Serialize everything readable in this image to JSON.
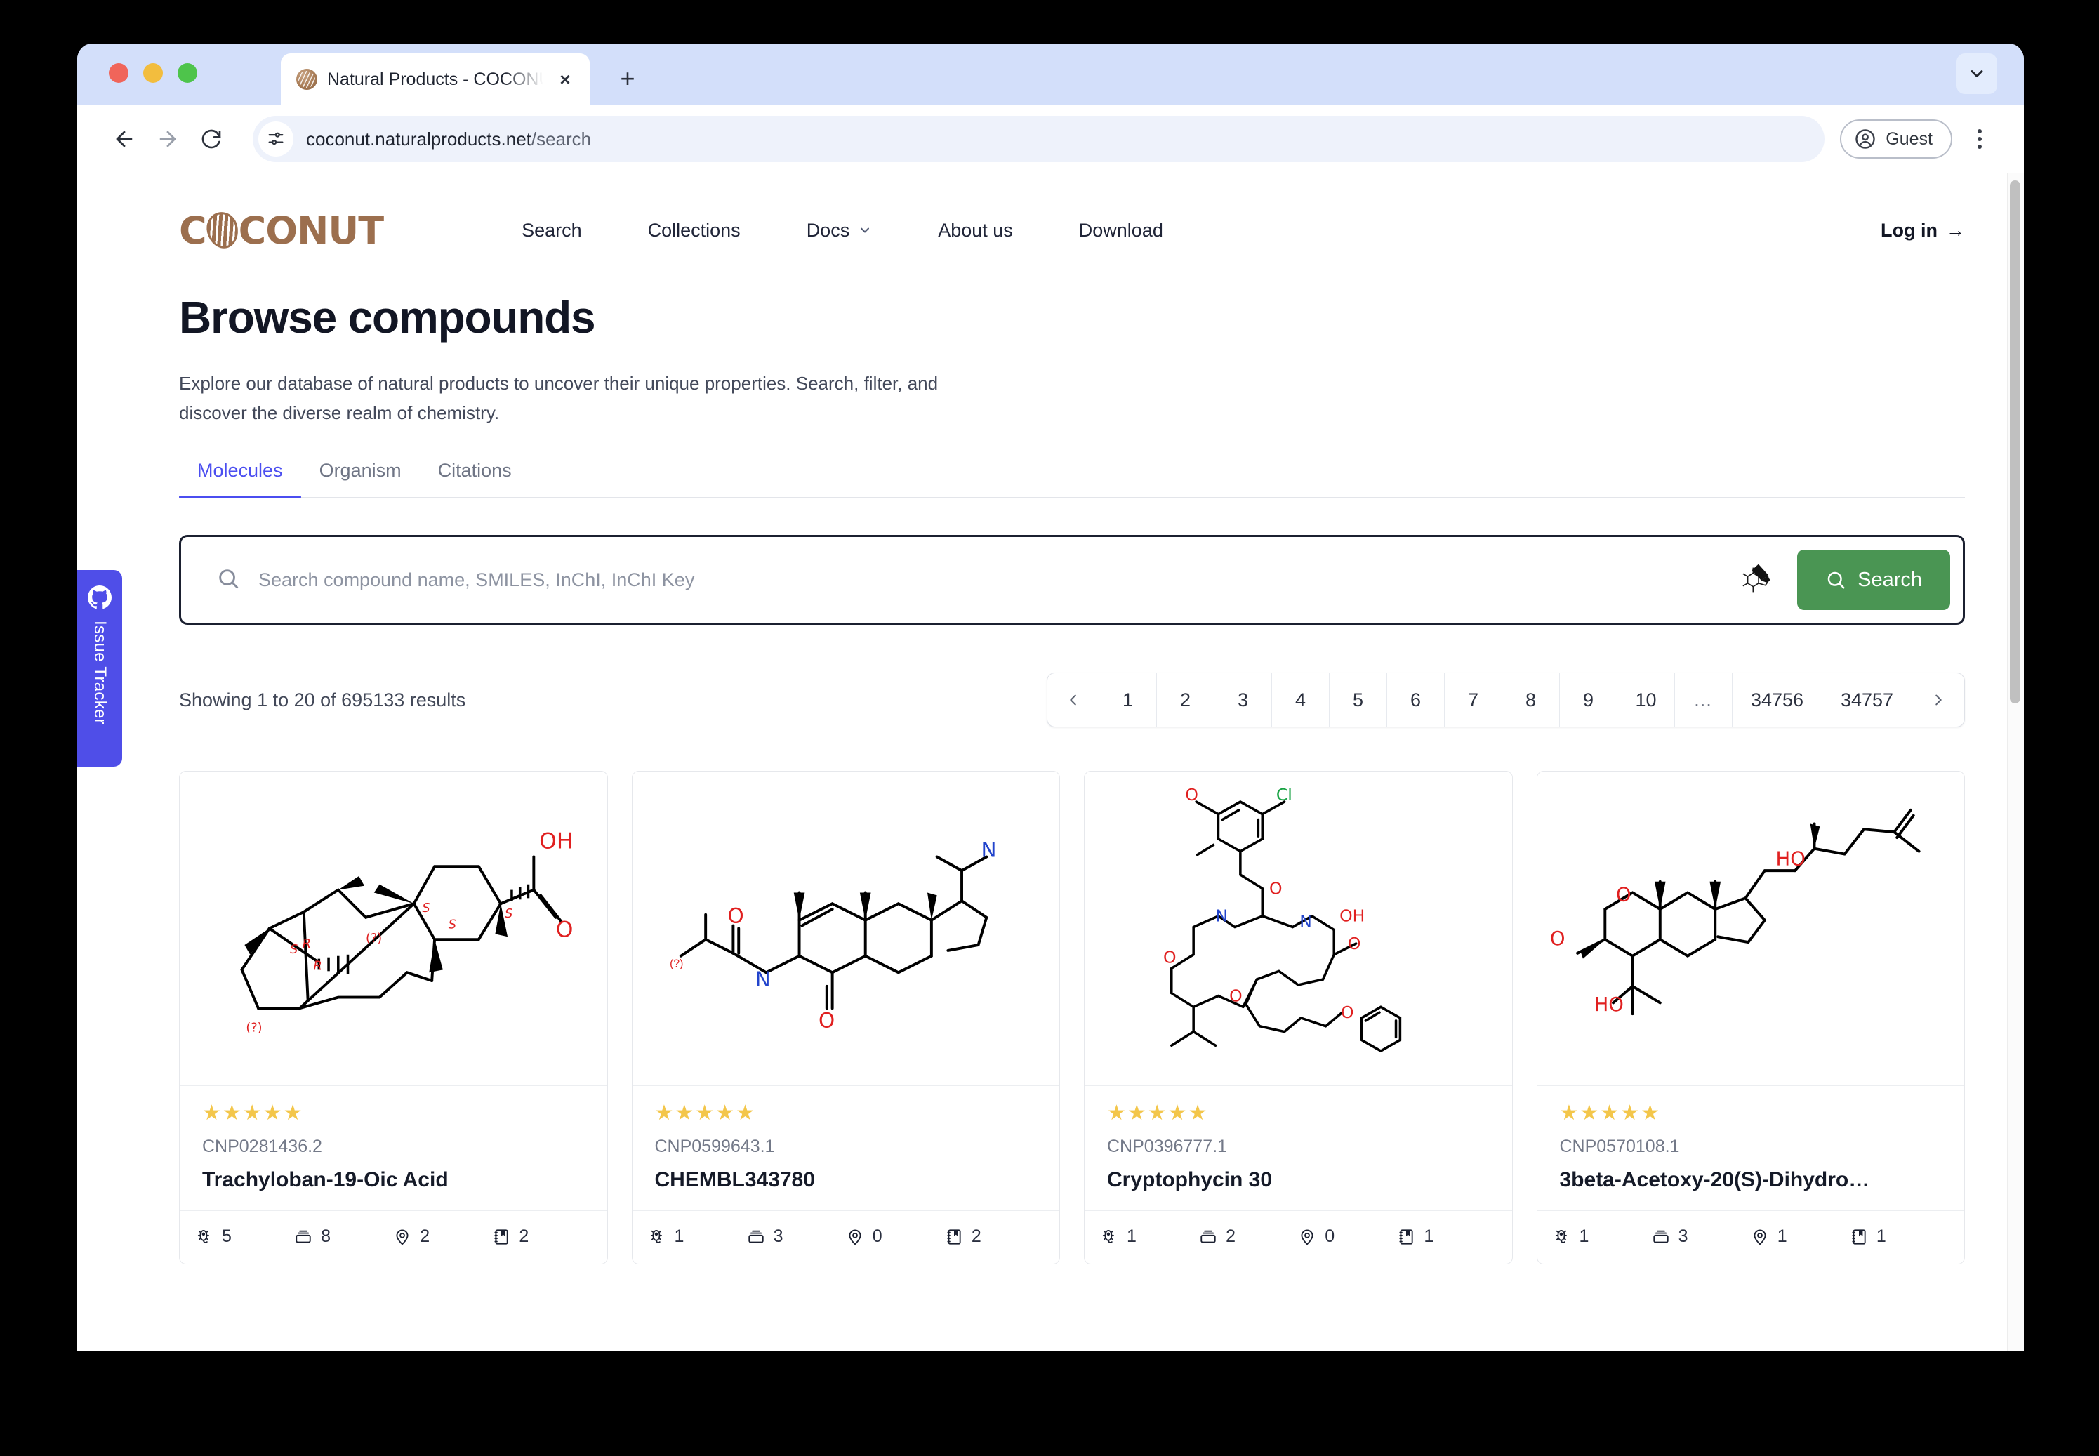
{
  "browser": {
    "tab_title": "Natural Products - COCONUT",
    "tab_favicon_name": "coconut-favicon",
    "new_tab_label": "+",
    "close_label": "×",
    "url_main": "coconut.naturalproducts.net",
    "url_path": "/search",
    "profile_label": "Guest",
    "back_icon": "back-arrow-icon",
    "forward_icon": "forward-arrow-icon",
    "reload_icon": "reload-icon",
    "site_info_icon": "site-settings-icon",
    "menu_icon": "kebab-menu-icon",
    "tabstrip_expand_icon": "chevron-down-icon"
  },
  "site": {
    "logo_text_left": "C",
    "logo_text_right": "CONUT",
    "nav": [
      {
        "label": "Search",
        "name": "nav-search"
      },
      {
        "label": "Collections",
        "name": "nav-collections"
      },
      {
        "label": "Docs",
        "name": "nav-docs",
        "caret": true
      },
      {
        "label": "About us",
        "name": "nav-about-us"
      },
      {
        "label": "Download",
        "name": "nav-download"
      }
    ],
    "login_label": "Log in",
    "login_arrow": "→"
  },
  "page": {
    "title": "Browse compounds",
    "description": "Explore our database of natural products to uncover their unique properties. Search, filter, and discover the diverse realm of chemistry.",
    "tabs": [
      {
        "label": "Molecules",
        "active": true
      },
      {
        "label": "Organism",
        "active": false
      },
      {
        "label": "Citations",
        "active": false
      }
    ]
  },
  "search": {
    "placeholder": "Search compound name, SMILES, InChI, InChI Key",
    "value": "",
    "button_label": "Search",
    "button_color": "#4a9553",
    "sketcher_icon": "molecule-sketcher-icon",
    "magnifier_icon": "search-icon"
  },
  "results": {
    "summary": "Showing 1 to 20 of 695133 results",
    "pagination": {
      "prev_icon": "chevron-left-icon",
      "next_icon": "chevron-right-icon",
      "pages": [
        "1",
        "2",
        "3",
        "4",
        "5",
        "6",
        "7",
        "8",
        "9",
        "10",
        "…",
        "34756",
        "34757"
      ],
      "current": "1"
    }
  },
  "cards": [
    {
      "rating": "★★★★★",
      "id": "CNP0281436.2",
      "name": "Trachyloban-19-Oic Acid",
      "structure": "trachyloban-19-oic-acid-structure",
      "stats": [
        {
          "icon": "organism-icon",
          "value": "5"
        },
        {
          "icon": "collection-icon",
          "value": "8"
        },
        {
          "icon": "geo-location-icon",
          "value": "2"
        },
        {
          "icon": "citation-icon",
          "value": "2"
        }
      ]
    },
    {
      "rating": "★★★★★",
      "id": "CNP0599643.1",
      "name": "CHEMBL343780",
      "structure": "chembl343780-structure",
      "stats": [
        {
          "icon": "organism-icon",
          "value": "1"
        },
        {
          "icon": "collection-icon",
          "value": "3"
        },
        {
          "icon": "geo-location-icon",
          "value": "0"
        },
        {
          "icon": "citation-icon",
          "value": "2"
        }
      ]
    },
    {
      "rating": "★★★★★",
      "id": "CNP0396777.1",
      "name": "Cryptophycin 30",
      "structure": "cryptophycin-30-structure",
      "stats": [
        {
          "icon": "organism-icon",
          "value": "1"
        },
        {
          "icon": "collection-icon",
          "value": "2"
        },
        {
          "icon": "geo-location-icon",
          "value": "0"
        },
        {
          "icon": "citation-icon",
          "value": "1"
        }
      ]
    },
    {
      "rating": "★★★★★",
      "id": "CNP0570108.1",
      "name": "3beta-Acetoxy-20(S)-Dihydro…",
      "structure": "3beta-acetoxy-20s-dihydro-structure",
      "stats": [
        {
          "icon": "organism-icon",
          "value": "1"
        },
        {
          "icon": "collection-icon",
          "value": "3"
        },
        {
          "icon": "geo-location-icon",
          "value": "1"
        },
        {
          "icon": "citation-icon",
          "value": "1"
        }
      ]
    }
  ],
  "issue_tracker": {
    "label": "Issue Tracker",
    "icon": "github-icon",
    "color": "#4f4ee8"
  },
  "colors": {
    "accent_tab": "#4b4ef0",
    "brand_brown": "#9c6f4e",
    "search_green": "#4a9553",
    "star_yellow": "#f3c64a"
  }
}
